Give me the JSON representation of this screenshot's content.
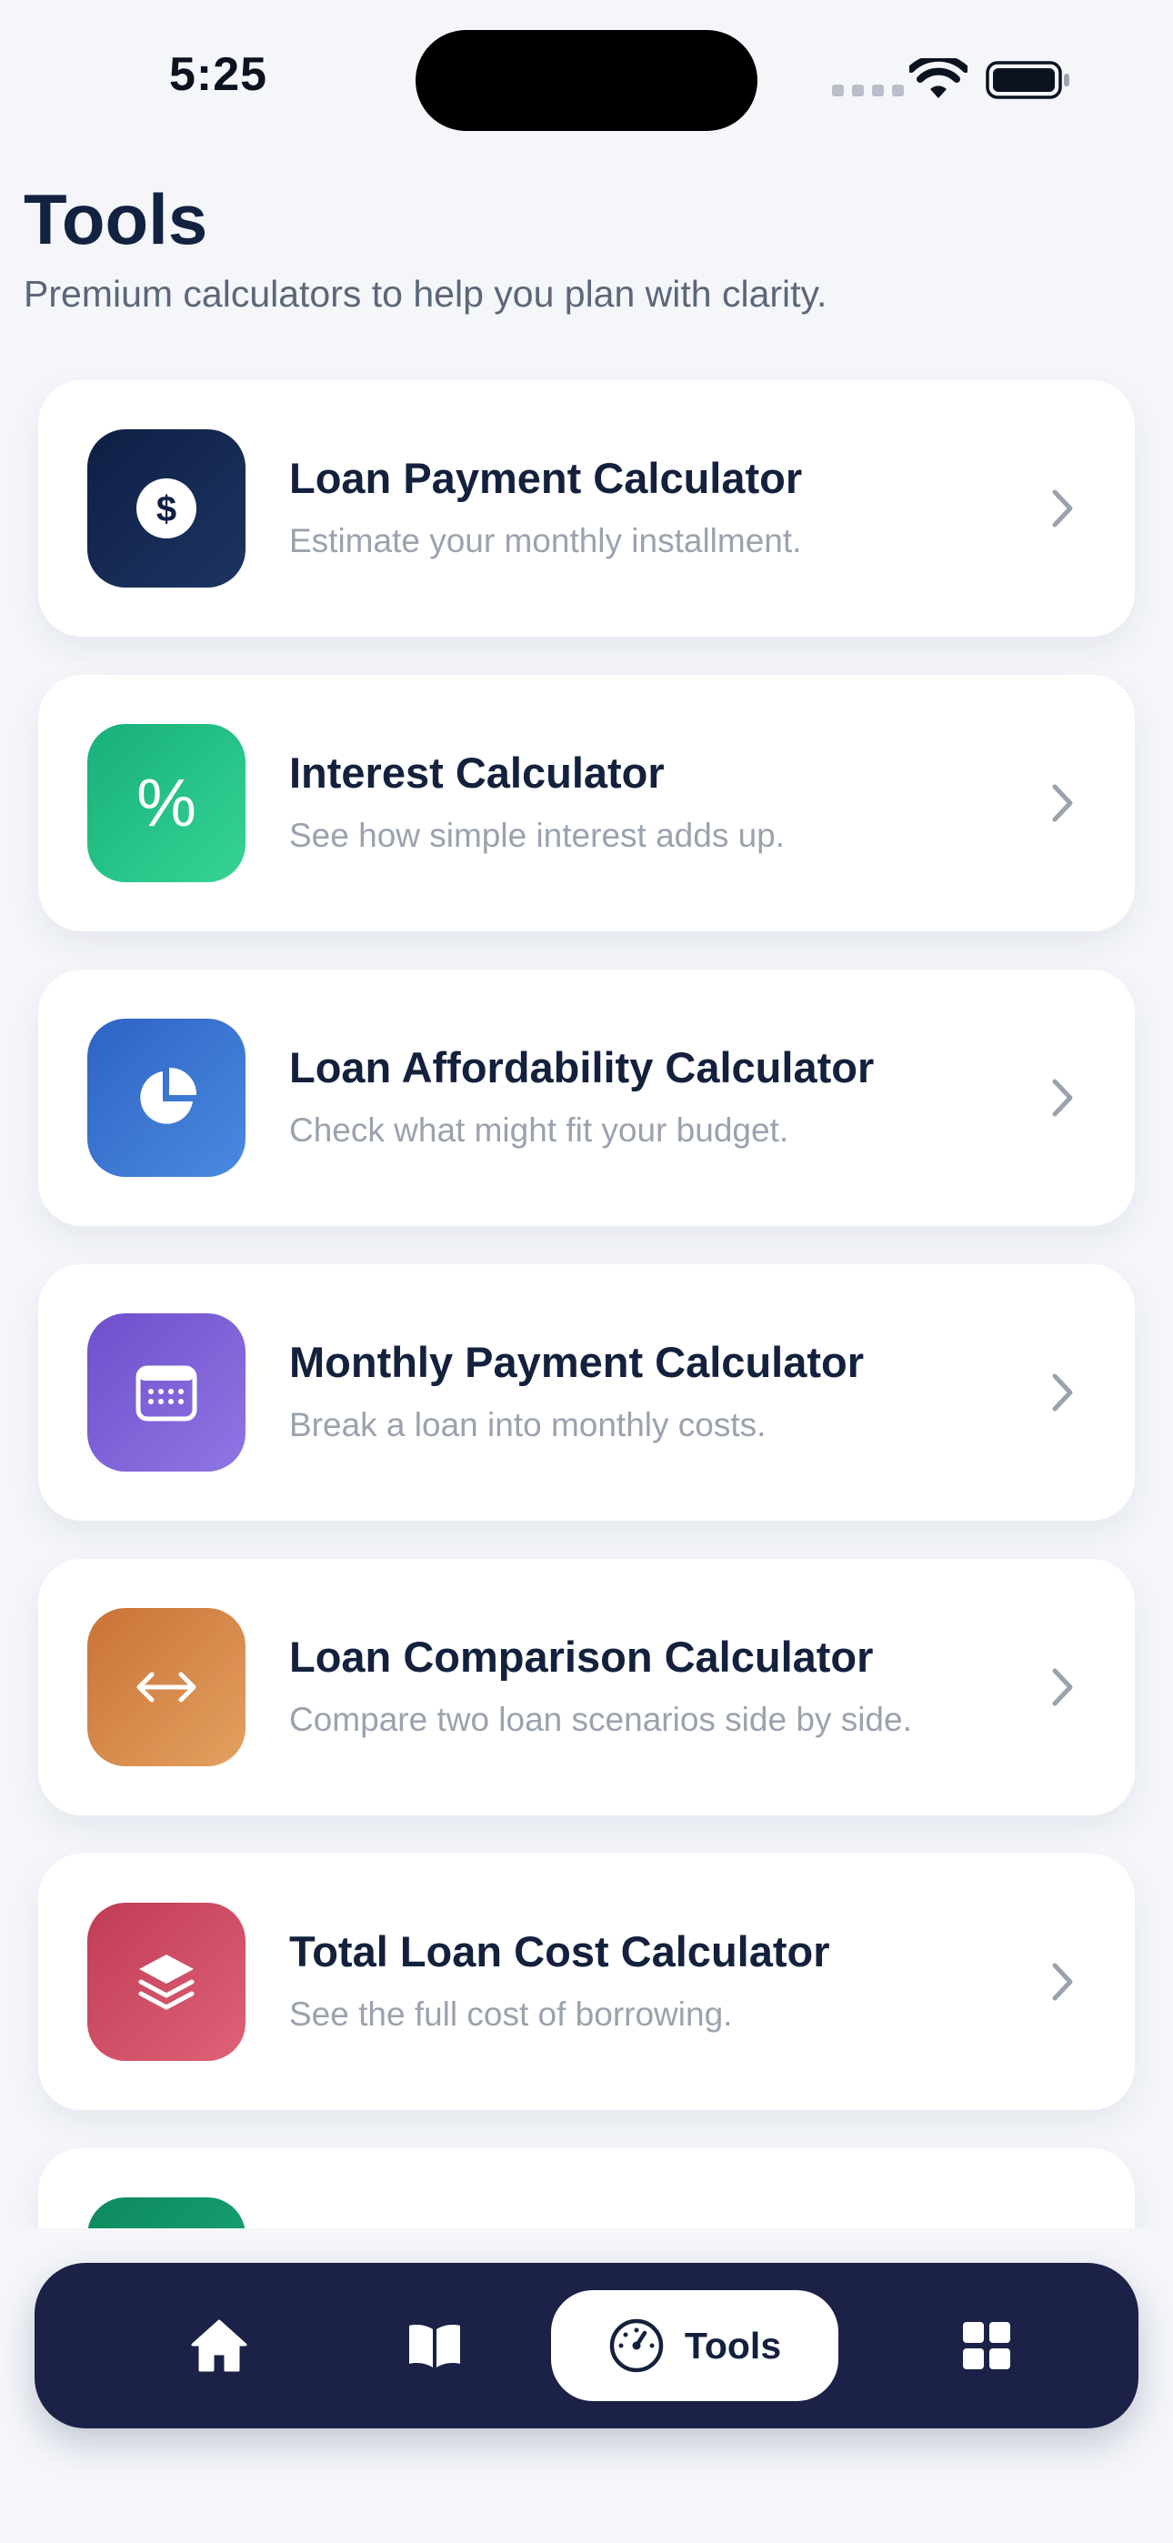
{
  "status_bar": {
    "time": "5:25"
  },
  "header": {
    "title": "Tools",
    "subtitle": "Premium calculators to help you plan with clarity."
  },
  "tools": [
    {
      "title": "Loan Payment Calculator",
      "description": "Estimate your monthly installment.",
      "icon": "dollar-icon",
      "gradient": [
        "#0f1f45",
        "#1c3461"
      ]
    },
    {
      "title": "Interest Calculator",
      "description": "See how simple interest adds up.",
      "icon": "percent-icon",
      "gradient": [
        "#17b079",
        "#36d395"
      ]
    },
    {
      "title": "Loan Affordability Calculator",
      "description": "Check what might fit your budget.",
      "icon": "pie-chart-icon",
      "gradient": [
        "#2e63c4",
        "#4a8ae0"
      ]
    },
    {
      "title": "Monthly Payment Calculator",
      "description": "Break a loan into monthly costs.",
      "icon": "calendar-icon",
      "gradient": [
        "#6e4fcc",
        "#9076e3"
      ]
    },
    {
      "title": "Loan Comparison Calculator",
      "description": "Compare two loan scenarios side by side.",
      "icon": "compare-arrows-icon",
      "gradient": [
        "#c97237",
        "#e3a160"
      ]
    },
    {
      "title": "Total Loan Cost Calculator",
      "description": "See the full cost of borrowing.",
      "icon": "layers-icon",
      "gradient": [
        "#c03c55",
        "#de6277"
      ]
    }
  ],
  "peek_card": {
    "gradient": [
      "#0e8a5f",
      "#1aa878"
    ]
  },
  "tab_bar": {
    "background": "#1b2147",
    "items": [
      {
        "name": "home",
        "icon": "home-icon"
      },
      {
        "name": "learn",
        "icon": "book-icon"
      },
      {
        "name": "tools",
        "icon": "gauge-icon",
        "label": "Tools",
        "active": true
      },
      {
        "name": "more",
        "icon": "grid-icon"
      }
    ]
  }
}
